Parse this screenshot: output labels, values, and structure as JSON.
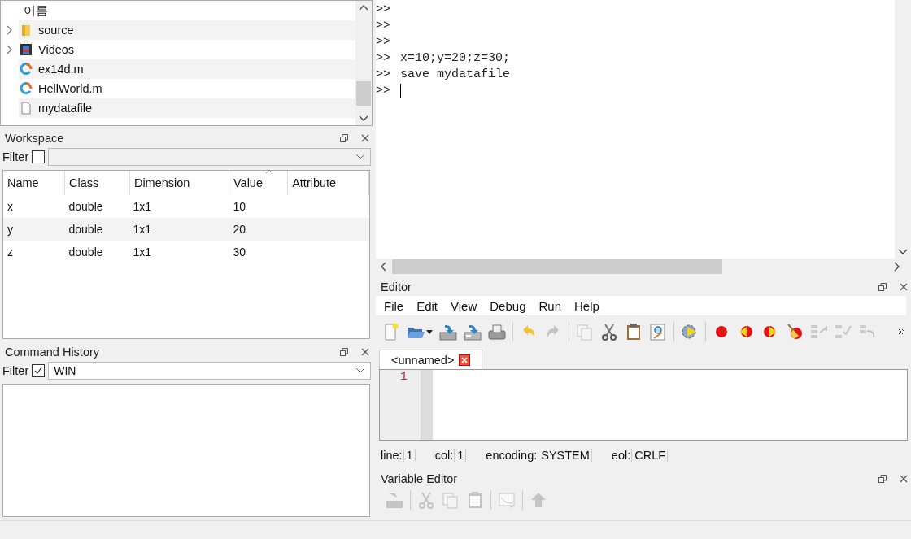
{
  "file_browser": {
    "header": "이름",
    "items": [
      {
        "kind": "folder",
        "name": "source",
        "expandable": true
      },
      {
        "kind": "video",
        "name": "Videos",
        "expandable": true
      },
      {
        "kind": "mfile",
        "name": "ex14d.m",
        "expandable": false
      },
      {
        "kind": "mfile",
        "name": "HellWorld.m",
        "expandable": false
      },
      {
        "kind": "file",
        "name": "mydatafile",
        "expandable": false
      }
    ]
  },
  "workspace": {
    "title": "Workspace",
    "filter_label": "Filter",
    "filter_checked": false,
    "columns": [
      {
        "label": "Name",
        "sorted": false
      },
      {
        "label": "Class",
        "sorted": false
      },
      {
        "label": "Dimension",
        "sorted": false
      },
      {
        "label": "Value",
        "sorted": true
      },
      {
        "label": "Attribute",
        "sorted": false
      }
    ],
    "rows": [
      [
        "x",
        "double",
        "1x1",
        "10",
        ""
      ],
      [
        "y",
        "double",
        "1x1",
        "20",
        ""
      ],
      [
        "z",
        "double",
        "1x1",
        "30",
        ""
      ]
    ]
  },
  "command_history": {
    "title": "Command History",
    "filter_label": "Filter",
    "filter_checked": true,
    "filter_value": "WIN"
  },
  "command_window": {
    "lines": [
      {
        "prompt": ">>",
        "cursor": false
      },
      {
        "prompt": ">>",
        "cursor": false
      },
      {
        "prompt": ">>",
        "cursor": false
      },
      {
        "prompt": ">>",
        "code": "x=10;y=20;z=30;",
        "cursor": false
      },
      {
        "prompt": ">>",
        "code": "save mydatafile",
        "cursor": false
      },
      {
        "prompt": ">>",
        "cursor": true
      }
    ]
  },
  "editor": {
    "title": "Editor",
    "menu": [
      "File",
      "Edit",
      "View",
      "Debug",
      "Run",
      "Help"
    ],
    "toolbar": [
      {
        "kind": "new",
        "disabled": false
      },
      {
        "kind": "open",
        "disabled": false
      },
      {
        "kind": "save",
        "disabled": false
      },
      {
        "kind": "saveas",
        "disabled": false
      },
      {
        "kind": "print",
        "disabled": false
      },
      {
        "kind": "sep"
      },
      {
        "kind": "undo",
        "disabled": false
      },
      {
        "kind": "redo",
        "disabled": true
      },
      {
        "kind": "sep"
      },
      {
        "kind": "copy",
        "disabled": true
      },
      {
        "kind": "cut",
        "disabled": false
      },
      {
        "kind": "paste",
        "disabled": false
      },
      {
        "kind": "find",
        "disabled": false
      },
      {
        "kind": "sep"
      },
      {
        "kind": "run",
        "disabled": false
      },
      {
        "kind": "sep"
      },
      {
        "kind": "breakpoint",
        "disabled": false
      },
      {
        "kind": "prevbp",
        "disabled": false
      },
      {
        "kind": "nextbp",
        "disabled": false
      },
      {
        "kind": "clearbp",
        "disabled": false
      },
      {
        "kind": "step",
        "disabled": true
      },
      {
        "kind": "stepin",
        "disabled": true
      },
      {
        "kind": "stepout",
        "disabled": true
      }
    ],
    "tabs": [
      {
        "label": "<unnamed>",
        "selected": true
      }
    ],
    "line_numbers": [
      "1"
    ],
    "status": [
      {
        "label": "line:",
        "value": "1"
      },
      {
        "label": "col:",
        "value": "1"
      },
      {
        "label": "encoding:",
        "value": "SYSTEM"
      },
      {
        "label": "eol:",
        "value": "CRLF"
      }
    ]
  },
  "variable_editor": {
    "title": "Variable Editor",
    "toolbar": [
      {
        "kind": "import",
        "disabled": true
      },
      {
        "kind": "sep"
      },
      {
        "kind": "cut",
        "disabled": true
      },
      {
        "kind": "copy",
        "disabled": true
      },
      {
        "kind": "paste",
        "disabled": true
      },
      {
        "kind": "sep"
      },
      {
        "kind": "plot",
        "disabled": true
      },
      {
        "kind": "sep"
      },
      {
        "kind": "up",
        "disabled": true
      }
    ]
  }
}
